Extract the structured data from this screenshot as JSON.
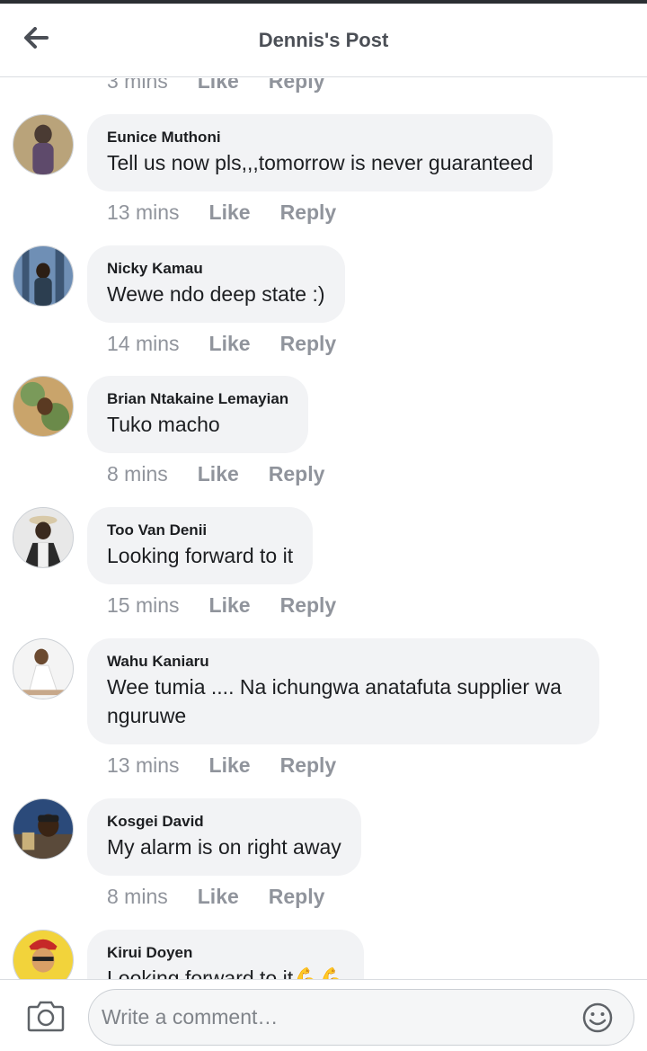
{
  "header": {
    "title": "Dennis's Post"
  },
  "clipped_meta": {
    "time": "3 mins",
    "like": "Like",
    "reply": "Reply"
  },
  "comments": [
    {
      "author": "Eunice Muthoni",
      "text": "Tell us now pls,,,tomorrow is never guaranteed",
      "time": "13 mins",
      "like": "Like",
      "reply": "Reply",
      "avatar_colors": [
        "#b9a37a",
        "#5e4a6b"
      ]
    },
    {
      "author": "Nicky Kamau",
      "text": "Wewe ndo deep state :)",
      "time": "14 mins",
      "like": "Like",
      "reply": "Reply",
      "avatar_colors": [
        "#6f8fb5",
        "#2c3e50"
      ]
    },
    {
      "author": "Brian Ntakaine Lemayian",
      "text": "Tuko macho",
      "time": "8 mins",
      "like": "Like",
      "reply": "Reply",
      "avatar_colors": [
        "#7a9a5a",
        "#c9a46b"
      ]
    },
    {
      "author": "Too Van Denii",
      "text": "Looking forward to it",
      "time": "15 mins",
      "like": "Like",
      "reply": "Reply",
      "avatar_colors": [
        "#e8e8e8",
        "#3a2a1e"
      ]
    },
    {
      "author": "Wahu Kaniaru",
      "text": "Wee tumia .... Na ichungwa anatafuta supplier wa nguruwe",
      "time": "13 mins",
      "like": "Like",
      "reply": "Reply",
      "avatar_colors": [
        "#f4f4f4",
        "#c7a88a"
      ]
    },
    {
      "author": "Kosgei David",
      "text": "My alarm is on right away",
      "time": "8 mins",
      "like": "Like",
      "reply": "Reply",
      "avatar_colors": [
        "#2b4a7a",
        "#1e1e1e"
      ]
    },
    {
      "author": "Kirui Doyen",
      "text": "Looking forward to it",
      "text_emoji": "💪💪",
      "time": "",
      "like": "",
      "reply": "",
      "avatar_colors": [
        "#f2d33b",
        "#c62828"
      ]
    }
  ],
  "footer": {
    "placeholder": "Write a comment…"
  },
  "icons": {
    "back": "arrow-left-icon",
    "camera": "camera-icon",
    "emoji": "smiley-icon"
  },
  "colors": {
    "bubble": "#f2f3f5",
    "meta_text": "#90949c",
    "title": "#4b4f56"
  }
}
